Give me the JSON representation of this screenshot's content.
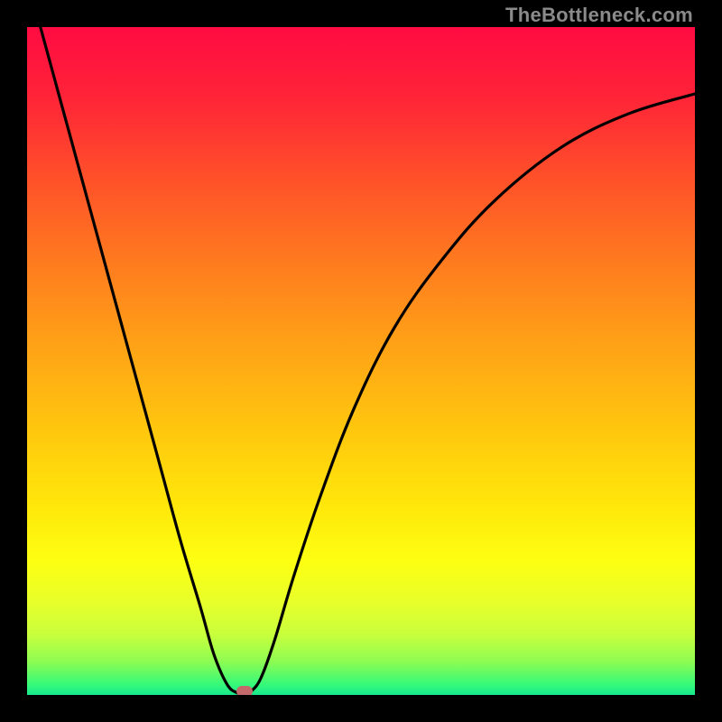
{
  "watermark": "TheBottleneck.com",
  "colors": {
    "frame": "#000000",
    "curve": "#000000",
    "marker": "#c46a6a",
    "gradient_stops": [
      {
        "offset": 0.0,
        "color": "#ff0b42"
      },
      {
        "offset": 0.1,
        "color": "#ff2238"
      },
      {
        "offset": 0.22,
        "color": "#ff4e2a"
      },
      {
        "offset": 0.35,
        "color": "#ff7a1f"
      },
      {
        "offset": 0.48,
        "color": "#ffa316"
      },
      {
        "offset": 0.6,
        "color": "#ffc60e"
      },
      {
        "offset": 0.72,
        "color": "#ffe80a"
      },
      {
        "offset": 0.8,
        "color": "#fdff12"
      },
      {
        "offset": 0.86,
        "color": "#e8ff2a"
      },
      {
        "offset": 0.91,
        "color": "#c8ff3c"
      },
      {
        "offset": 0.95,
        "color": "#8efc52"
      },
      {
        "offset": 0.985,
        "color": "#34f97a"
      },
      {
        "offset": 1.0,
        "color": "#17e98d"
      }
    ]
  },
  "chart_data": {
    "type": "line",
    "title": "",
    "xlabel": "",
    "ylabel": "",
    "xlim": [
      0,
      100
    ],
    "ylim": [
      0,
      100
    ],
    "grid": false,
    "legend": false,
    "series": [
      {
        "name": "bottleneck-curve",
        "x": [
          2,
          5,
          8,
          11,
          14,
          17,
          20,
          23,
          26,
          28,
          30,
          31.5,
          32.5,
          33.5,
          35,
          37,
          40,
          44,
          49,
          55,
          62,
          70,
          80,
          90,
          100
        ],
        "y": [
          100,
          89,
          78,
          67,
          56,
          45,
          34,
          23,
          13,
          6,
          1.5,
          0.3,
          0,
          0.5,
          2.5,
          8,
          18,
          30,
          43,
          55,
          65,
          74,
          82,
          87,
          90
        ]
      }
    ],
    "annotations": [
      {
        "name": "optimum-marker",
        "x": 32.5,
        "y": 0
      }
    ]
  }
}
